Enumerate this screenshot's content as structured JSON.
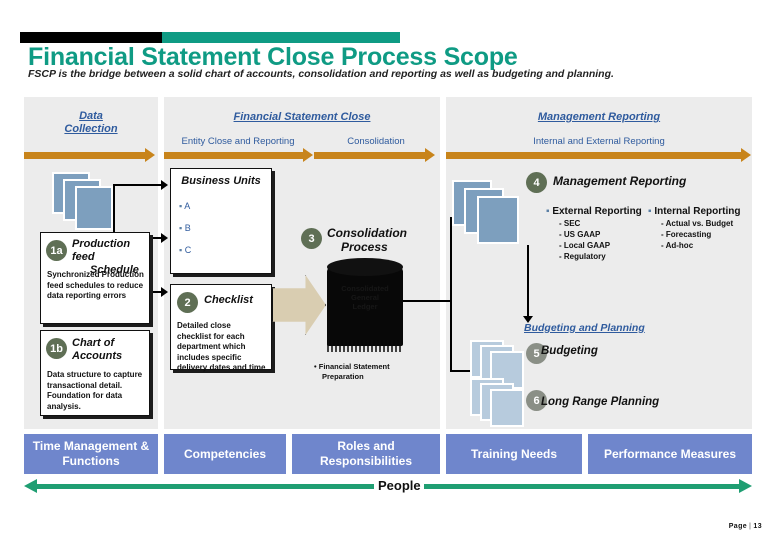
{
  "deck": {
    "title": "Financial Statement Close Process Scope",
    "subtitle": "FSCP is the bridge between a solid chart of accounts, consolidation and reporting as well as budgeting and planning.",
    "page_label": "Page",
    "page_number": "13",
    "accent_teal": "#0f9b84",
    "accent_orange": "#c8841b",
    "accent_blue": "#2f5b9e",
    "people_blue": "#6f86cc",
    "green": "#1f9e72"
  },
  "columns": {
    "left": {
      "title": "Data\nCollection",
      "title_line1": "Data",
      "title_line2": "Collection"
    },
    "middle": {
      "title": "Financial Statement Close",
      "sub_left": "Entity Close and Reporting",
      "sub_right": "Consolidation"
    },
    "right": {
      "title": "Management Reporting",
      "sub": "Internal and External Reporting"
    }
  },
  "boxes": {
    "production_feed": {
      "num": "1a",
      "head_line1": "Production",
      "head_line2": "feed",
      "head_line3": "Schedule",
      "body": "Synchronized Production feed schedules to reduce data reporting errors"
    },
    "chart_of_accounts": {
      "num": "1b",
      "head_line1": "Chart of",
      "head_line2": "Accounts",
      "body": "Data structure to capture transactional detail.  Foundation for data analysis."
    },
    "business_units": {
      "head": "Business Units",
      "items": [
        "A",
        "B",
        "C"
      ]
    },
    "checklist": {
      "num": "2",
      "head": "Checklist",
      "body": "Detailed close checklist for each department which includes specific delivery dates and time"
    },
    "consolidation": {
      "num": "3",
      "head_line1": "Consolidation",
      "head_line2": "Process",
      "cylinder_text": "Consolidated\nGeneral\nLedger",
      "caption_bullet": "•",
      "caption_line1": "Financial Statement",
      "caption_line2": "Preparation"
    },
    "management_reporting": {
      "num": "4",
      "head": "Management Reporting",
      "external": {
        "head": "External Reporting",
        "items": [
          "-  SEC",
          "-  US GAAP",
          "-  Local GAAP",
          "-  Regulatory"
        ]
      },
      "internal": {
        "head": "Internal Reporting",
        "items": [
          "-  Actual vs. Budget",
          "-  Forecasting",
          "-  Ad-hoc"
        ]
      }
    },
    "budgeting_planning": {
      "section_title": "Budgeting and Planning",
      "budgeting": {
        "num": "5",
        "head": "Budgeting"
      },
      "long_range": {
        "num": "6",
        "head": "Long Range Planning"
      }
    }
  },
  "people_row": {
    "label": "People",
    "boxes": [
      {
        "line1": "Time Management &",
        "line2": "Functions"
      },
      {
        "line1": "Competencies",
        "line2": ""
      },
      {
        "line1": "Roles and",
        "line2": "Responsibilities"
      },
      {
        "line1": "Training Needs",
        "line2": ""
      },
      {
        "line1": "Performance Measures",
        "line2": ""
      }
    ]
  }
}
